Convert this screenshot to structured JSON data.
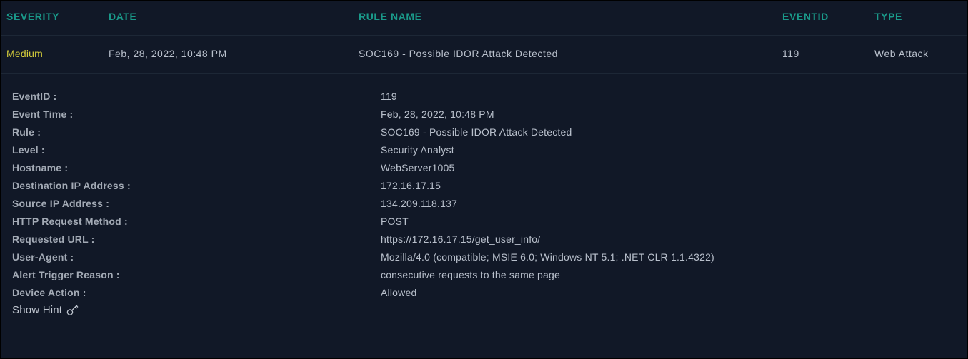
{
  "table": {
    "headers": {
      "severity": "SEVERITY",
      "date": "DATE",
      "rule_name": "RULE NAME",
      "eventid": "EVENTID",
      "type": "TYPE"
    },
    "row": {
      "severity": "Medium",
      "date": "Feb, 28, 2022, 10:48 PM",
      "rule_name": "SOC169 - Possible IDOR Attack Detected",
      "eventid": "119",
      "type": "Web Attack"
    }
  },
  "details": [
    {
      "label": "EventID :",
      "value": "119"
    },
    {
      "label": "Event Time :",
      "value": "Feb, 28, 2022, 10:48 PM"
    },
    {
      "label": "Rule :",
      "value": "SOC169 - Possible IDOR Attack Detected"
    },
    {
      "label": "Level :",
      "value": "Security Analyst"
    },
    {
      "label": "Hostname :",
      "value": "WebServer1005"
    },
    {
      "label": "Destination IP Address :",
      "value": "172.16.17.15"
    },
    {
      "label": "Source IP Address :",
      "value": "134.209.118.137"
    },
    {
      "label": "HTTP Request Method :",
      "value": "POST"
    },
    {
      "label": "Requested URL :",
      "value": "https://172.16.17.15/get_user_info/"
    },
    {
      "label": "User-Agent :",
      "value": "Mozilla/4.0 (compatible; MSIE 6.0; Windows NT 5.1; .NET CLR 1.1.4322)"
    },
    {
      "label": "Alert Trigger Reason :",
      "value": "consecutive requests to the same page"
    },
    {
      "label": "Device Action :",
      "value": "Allowed"
    }
  ],
  "hint": {
    "label": "Show Hint",
    "icon": "key-icon"
  },
  "colors": {
    "accent": "#1a9a8a",
    "severity_medium": "#d4cc3b",
    "background": "#111827"
  }
}
